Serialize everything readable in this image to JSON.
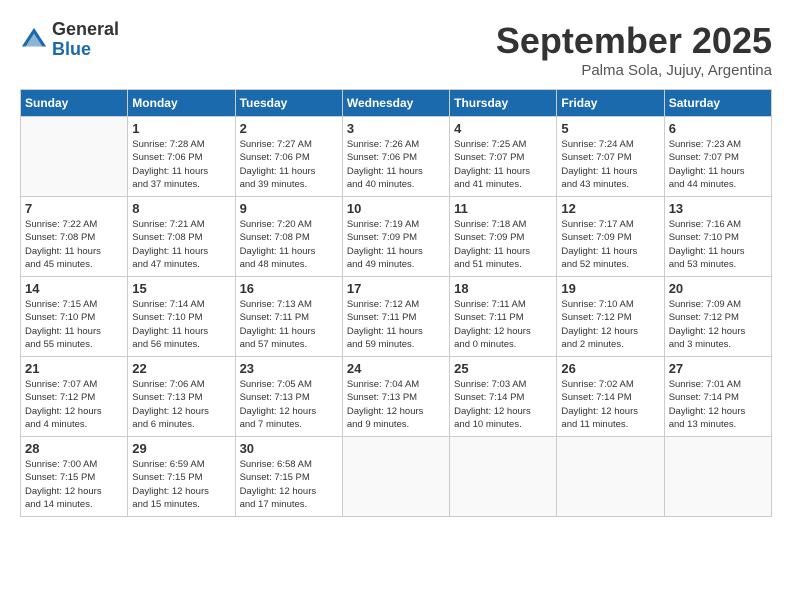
{
  "header": {
    "logo_general": "General",
    "logo_blue": "Blue",
    "month": "September 2025",
    "location": "Palma Sola, Jujuy, Argentina"
  },
  "days_of_week": [
    "Sunday",
    "Monday",
    "Tuesday",
    "Wednesday",
    "Thursday",
    "Friday",
    "Saturday"
  ],
  "weeks": [
    [
      {
        "day": "",
        "info": ""
      },
      {
        "day": "1",
        "info": "Sunrise: 7:28 AM\nSunset: 7:06 PM\nDaylight: 11 hours\nand 37 minutes."
      },
      {
        "day": "2",
        "info": "Sunrise: 7:27 AM\nSunset: 7:06 PM\nDaylight: 11 hours\nand 39 minutes."
      },
      {
        "day": "3",
        "info": "Sunrise: 7:26 AM\nSunset: 7:06 PM\nDaylight: 11 hours\nand 40 minutes."
      },
      {
        "day": "4",
        "info": "Sunrise: 7:25 AM\nSunset: 7:07 PM\nDaylight: 11 hours\nand 41 minutes."
      },
      {
        "day": "5",
        "info": "Sunrise: 7:24 AM\nSunset: 7:07 PM\nDaylight: 11 hours\nand 43 minutes."
      },
      {
        "day": "6",
        "info": "Sunrise: 7:23 AM\nSunset: 7:07 PM\nDaylight: 11 hours\nand 44 minutes."
      }
    ],
    [
      {
        "day": "7",
        "info": "Sunrise: 7:22 AM\nSunset: 7:08 PM\nDaylight: 11 hours\nand 45 minutes."
      },
      {
        "day": "8",
        "info": "Sunrise: 7:21 AM\nSunset: 7:08 PM\nDaylight: 11 hours\nand 47 minutes."
      },
      {
        "day": "9",
        "info": "Sunrise: 7:20 AM\nSunset: 7:08 PM\nDaylight: 11 hours\nand 48 minutes."
      },
      {
        "day": "10",
        "info": "Sunrise: 7:19 AM\nSunset: 7:09 PM\nDaylight: 11 hours\nand 49 minutes."
      },
      {
        "day": "11",
        "info": "Sunrise: 7:18 AM\nSunset: 7:09 PM\nDaylight: 11 hours\nand 51 minutes."
      },
      {
        "day": "12",
        "info": "Sunrise: 7:17 AM\nSunset: 7:09 PM\nDaylight: 11 hours\nand 52 minutes."
      },
      {
        "day": "13",
        "info": "Sunrise: 7:16 AM\nSunset: 7:10 PM\nDaylight: 11 hours\nand 53 minutes."
      }
    ],
    [
      {
        "day": "14",
        "info": "Sunrise: 7:15 AM\nSunset: 7:10 PM\nDaylight: 11 hours\nand 55 minutes."
      },
      {
        "day": "15",
        "info": "Sunrise: 7:14 AM\nSunset: 7:10 PM\nDaylight: 11 hours\nand 56 minutes."
      },
      {
        "day": "16",
        "info": "Sunrise: 7:13 AM\nSunset: 7:11 PM\nDaylight: 11 hours\nand 57 minutes."
      },
      {
        "day": "17",
        "info": "Sunrise: 7:12 AM\nSunset: 7:11 PM\nDaylight: 11 hours\nand 59 minutes."
      },
      {
        "day": "18",
        "info": "Sunrise: 7:11 AM\nSunset: 7:11 PM\nDaylight: 12 hours\nand 0 minutes."
      },
      {
        "day": "19",
        "info": "Sunrise: 7:10 AM\nSunset: 7:12 PM\nDaylight: 12 hours\nand 2 minutes."
      },
      {
        "day": "20",
        "info": "Sunrise: 7:09 AM\nSunset: 7:12 PM\nDaylight: 12 hours\nand 3 minutes."
      }
    ],
    [
      {
        "day": "21",
        "info": "Sunrise: 7:07 AM\nSunset: 7:12 PM\nDaylight: 12 hours\nand 4 minutes."
      },
      {
        "day": "22",
        "info": "Sunrise: 7:06 AM\nSunset: 7:13 PM\nDaylight: 12 hours\nand 6 minutes."
      },
      {
        "day": "23",
        "info": "Sunrise: 7:05 AM\nSunset: 7:13 PM\nDaylight: 12 hours\nand 7 minutes."
      },
      {
        "day": "24",
        "info": "Sunrise: 7:04 AM\nSunset: 7:13 PM\nDaylight: 12 hours\nand 9 minutes."
      },
      {
        "day": "25",
        "info": "Sunrise: 7:03 AM\nSunset: 7:14 PM\nDaylight: 12 hours\nand 10 minutes."
      },
      {
        "day": "26",
        "info": "Sunrise: 7:02 AM\nSunset: 7:14 PM\nDaylight: 12 hours\nand 11 minutes."
      },
      {
        "day": "27",
        "info": "Sunrise: 7:01 AM\nSunset: 7:14 PM\nDaylight: 12 hours\nand 13 minutes."
      }
    ],
    [
      {
        "day": "28",
        "info": "Sunrise: 7:00 AM\nSunset: 7:15 PM\nDaylight: 12 hours\nand 14 minutes."
      },
      {
        "day": "29",
        "info": "Sunrise: 6:59 AM\nSunset: 7:15 PM\nDaylight: 12 hours\nand 15 minutes."
      },
      {
        "day": "30",
        "info": "Sunrise: 6:58 AM\nSunset: 7:15 PM\nDaylight: 12 hours\nand 17 minutes."
      },
      {
        "day": "",
        "info": ""
      },
      {
        "day": "",
        "info": ""
      },
      {
        "day": "",
        "info": ""
      },
      {
        "day": "",
        "info": ""
      }
    ]
  ]
}
